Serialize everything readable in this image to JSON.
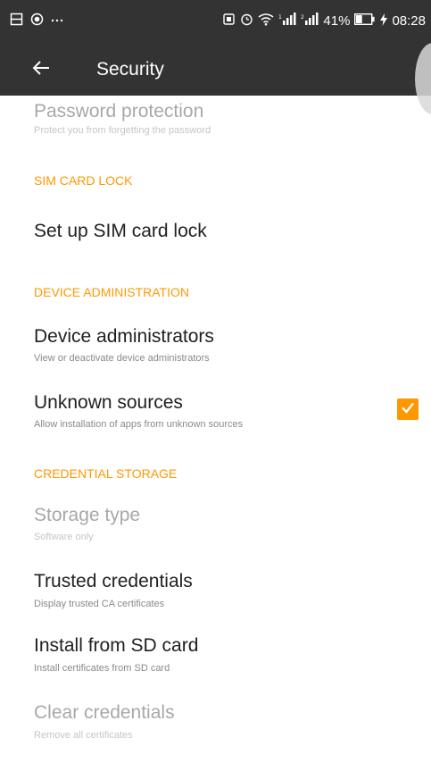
{
  "status_bar": {
    "left_icons": [
      "screenshot-icon",
      "record-icon",
      "more-notifications-icon"
    ],
    "right_icons": [
      "vibrate-icon",
      "alarm-icon",
      "wifi-icon",
      "signal-1-icon",
      "signal-2-icon"
    ],
    "battery_percent": "41%",
    "battery_level": 0.41,
    "time": "08:28"
  },
  "toolbar": {
    "title": "Security",
    "back_icon": "arrow-back-icon"
  },
  "items": {
    "password_protection": {
      "title": "Password protection",
      "summary": "Protect you from forgetting the password",
      "enabled": false
    },
    "sim_lock_header": "SIM CARD LOCK",
    "sim_lock": {
      "title": "Set up SIM card lock"
    },
    "device_admin_header": "DEVICE ADMINISTRATION",
    "device_admins": {
      "title": "Device administrators",
      "summary": "View or deactivate device administrators"
    },
    "unknown_sources": {
      "title": "Unknown sources",
      "summary": "Allow installation of apps from unknown sources",
      "checked": true
    },
    "credential_storage_header": "CREDENTIAL STORAGE",
    "storage_type": {
      "title": "Storage type",
      "summary": "Software only",
      "enabled": false
    },
    "trusted_credentials": {
      "title": "Trusted credentials",
      "summary": "Display trusted CA certificates"
    },
    "install_from_sd": {
      "title": "Install from SD card",
      "summary": "Install certificates from SD card"
    },
    "clear_credentials": {
      "title": "Clear credentials",
      "summary": "Remove all certificates",
      "enabled": false
    }
  },
  "colors": {
    "bar_background": "#333333",
    "accent": "#ff9800",
    "primary_text": "#212121",
    "secondary_text": "#8a8a8a",
    "disabled_text": "#a8a8a8"
  }
}
